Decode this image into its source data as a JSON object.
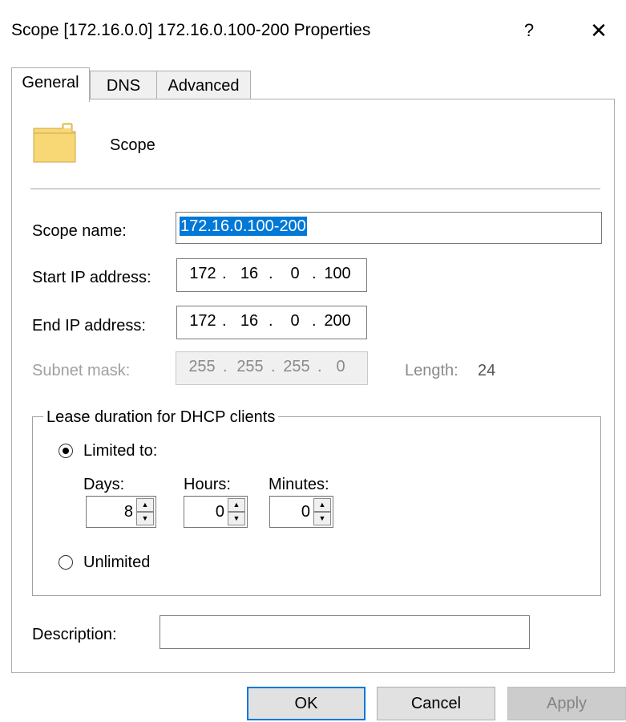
{
  "window": {
    "title": "Scope [172.16.0.0] 172.16.0.100-200 Properties",
    "help_label": "?",
    "close_label": "✕"
  },
  "tabs": [
    {
      "label": "General",
      "active": true
    },
    {
      "label": "DNS",
      "active": false
    },
    {
      "label": "Advanced",
      "active": false
    }
  ],
  "general": {
    "icon": "folder-icon",
    "heading": "Scope",
    "scope_name_label": "Scope name:",
    "scope_name_value": "172.16.0.100-200",
    "start_ip_label": "Start IP address:",
    "start_ip": [
      "172",
      "16",
      "0",
      "100"
    ],
    "end_ip_label": "End IP address:",
    "end_ip": [
      "172",
      "16",
      "0",
      "200"
    ],
    "subnet_mask_label": "Subnet mask:",
    "subnet_mask": [
      "255",
      "255",
      "255",
      "0"
    ],
    "length_label": "Length:",
    "length_value": "24",
    "lease": {
      "group_label": "Lease duration for DHCP clients",
      "limited_label": "Limited to:",
      "limited_selected": true,
      "days_label": "Days:",
      "days_value": "8",
      "hours_label": "Hours:",
      "hours_value": "0",
      "minutes_label": "Minutes:",
      "minutes_value": "0",
      "unlimited_label": "Unlimited",
      "unlimited_selected": false
    },
    "description_label": "Description:",
    "description_value": ""
  },
  "buttons": {
    "ok": "OK",
    "cancel": "Cancel",
    "apply": "Apply"
  },
  "colors": {
    "selection": "#0078d7",
    "folder": "#f8d775"
  }
}
